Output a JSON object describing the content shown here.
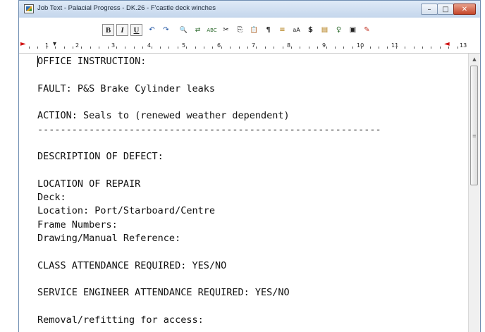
{
  "window": {
    "title": "Job Text - Palacial Progress - DK.26 - F'castle deck winches",
    "controls": {
      "minimize": "–",
      "maximize": "□",
      "close": "✕"
    }
  },
  "toolbar": {
    "bold": "B",
    "italic": "I",
    "underline": "U",
    "undo": "↶",
    "redo": "↷",
    "find": "🔍",
    "replace": "⇄",
    "spell": "ABC",
    "cut": "✂",
    "copy": "⎘",
    "paste": "📋",
    "pilcrow": "¶",
    "t1": "≡",
    "t2": "aA",
    "dollar": "$",
    "t3": "▤",
    "t4": "♀",
    "t5": "▣",
    "t6": "✎"
  },
  "ruler": {
    "labels": [
      "1",
      "2",
      "3",
      "4",
      "5",
      "6",
      "7",
      "8",
      "9",
      "10",
      "11",
      "13"
    ]
  },
  "document": {
    "lines": [
      "OFFICE INSTRUCTION:",
      "",
      "FAULT: P&S Brake Cylinder leaks",
      "",
      "ACTION: Seals to (renewed weather dependent)",
      "------------------------------------------------------------",
      "",
      "DESCRIPTION OF DEFECT:",
      "",
      "LOCATION OF REPAIR",
      "Deck:",
      "Location: Port/Starboard/Centre",
      "Frame Numbers:",
      "Drawing/Manual Reference:",
      "",
      "CLASS ATTENDANCE REQUIRED: YES/NO",
      "",
      "SERVICE ENGINEER ATTENDANCE REQUIRED: YES/NO",
      "",
      "Removal/refitting for access:"
    ]
  },
  "scrollbar": {
    "up": "▲",
    "down": "▼",
    "grip": "≡"
  }
}
